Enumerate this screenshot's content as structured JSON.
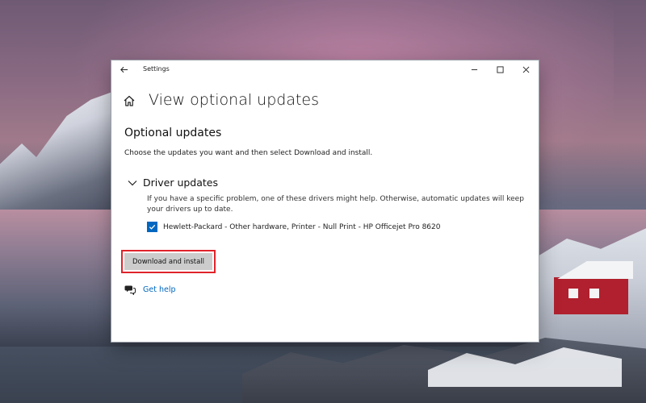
{
  "window": {
    "title": "Settings"
  },
  "page": {
    "title": "View optional updates"
  },
  "optional_updates": {
    "heading": "Optional updates",
    "description": "Choose the updates you want and then select Download and install."
  },
  "driver_updates": {
    "heading": "Driver updates",
    "expanded": true,
    "description": "If you have a specific problem, one of these drivers might help. Otherwise, automatic updates will keep your drivers up to date.",
    "items": [
      {
        "label": "Hewlett-Packard  - Other hardware, Printer - Null Print - HP Officejet Pro 8620",
        "checked": true
      }
    ]
  },
  "actions": {
    "download_label": "Download and install"
  },
  "help": {
    "link_label": "Get help"
  },
  "icons": {
    "back": "back-arrow-icon",
    "minimize": "minimize-icon",
    "maximize": "maximize-icon",
    "close": "close-icon",
    "home": "home-icon",
    "chevron": "chevron-down-icon",
    "checkbox": "checkmark-icon",
    "help": "chat-help-icon"
  },
  "colors": {
    "accent": "#0067c0",
    "highlight": "#e0232b",
    "button_bg": "#cccccc"
  }
}
